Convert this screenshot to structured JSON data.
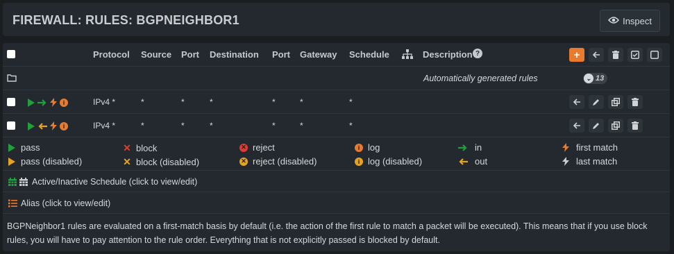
{
  "page": {
    "title": "FIREWALL: RULES: BGPNEIGHBOR1",
    "inspect_label": "Inspect"
  },
  "table": {
    "headers": {
      "protocol": "Protocol",
      "source": "Source",
      "port1": "Port",
      "destination": "Destination",
      "port2": "Port",
      "gateway": "Gateway",
      "schedule": "Schedule",
      "description": "Description"
    },
    "group": {
      "label": "Automatically generated rules",
      "count": "13"
    },
    "rows": [
      {
        "protocol": "IPv4 *",
        "source": "*",
        "source_port": "*",
        "destination": "*",
        "dest_port": "*",
        "gateway": "*",
        "schedule": "*",
        "direction": "in"
      },
      {
        "protocol": "IPv4 *",
        "source": "*",
        "source_port": "*",
        "destination": "*",
        "dest_port": "*",
        "gateway": "*",
        "schedule": "*",
        "direction": "out"
      }
    ]
  },
  "legend": {
    "pass": "pass",
    "pass_disabled": "pass (disabled)",
    "block": "block",
    "block_disabled": "block (disabled)",
    "reject": "reject",
    "reject_disabled": "reject (disabled)",
    "log": "log",
    "log_disabled": "log (disabled)",
    "in": "in",
    "out": "out",
    "first_match": "first match",
    "last_match": "last match"
  },
  "schedule_note": "Active/Inactive Schedule (click to view/edit)",
  "alias_note": "Alias (click to view/edit)",
  "description": "BGPNeighbor1 rules are evaluated on a first-match basis by default (i.e. the action of the first rule to match a packet will be executed). This means that if you use block rules, you will have to pay attention to the rule order. Everything that is not explicitly passed is blocked by default.",
  "colors": {
    "pass": "#1fa03a",
    "disabled": "#e6a323",
    "block": "#e03c31",
    "log": "#e87b2d",
    "accent": "#e87b2d"
  }
}
